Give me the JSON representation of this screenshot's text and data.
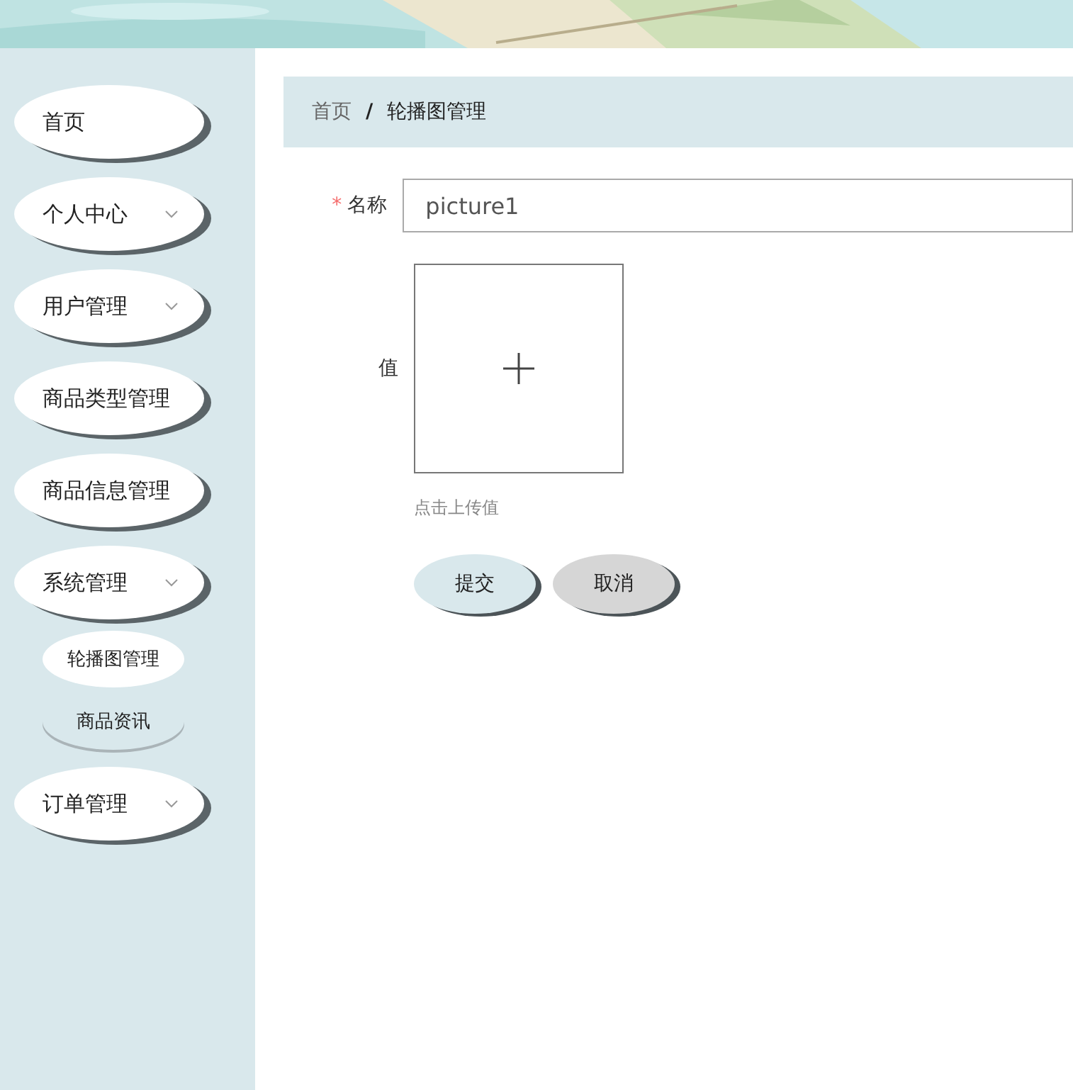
{
  "menu": [
    {
      "label": "首页",
      "expandable": false
    },
    {
      "label": "个人中心",
      "expandable": true
    },
    {
      "label": "用户管理",
      "expandable": true
    },
    {
      "label": "商品类型管理",
      "expandable": false
    },
    {
      "label": "商品信息管理",
      "expandable": false
    },
    {
      "label": "系统管理",
      "expandable": true,
      "children": [
        {
          "label": "轮播图管理",
          "selected": true
        },
        {
          "label": "商品资讯",
          "selected": false
        }
      ]
    },
    {
      "label": "订单管理",
      "expandable": true
    }
  ],
  "breadcrumb": [
    "首页",
    "轮播图管理"
  ],
  "breadcrumb_separator": "/",
  "form": {
    "required_mark": "*",
    "fields": [
      {
        "kind": "text",
        "label": "名称",
        "required": true,
        "value": "picture1"
      },
      {
        "kind": "upload",
        "label": "值",
        "required": false,
        "hint": "点击上传值"
      }
    ],
    "buttons": [
      {
        "label": "提交",
        "kind": "primary"
      },
      {
        "label": "取消",
        "kind": "default"
      }
    ]
  }
}
